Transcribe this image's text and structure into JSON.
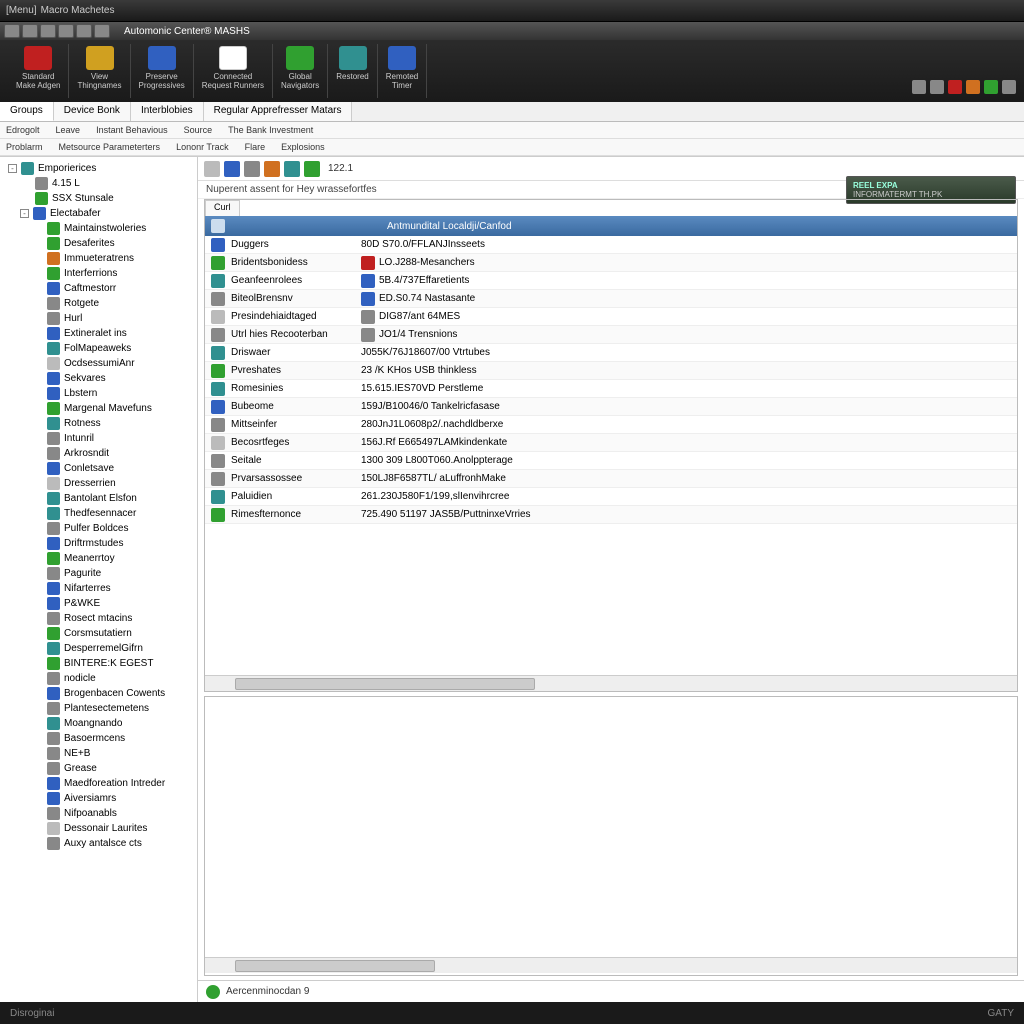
{
  "titlebar": {
    "app": "Macro Machetes"
  },
  "ribbon_header": {
    "title": "Automonic Center® MASHS"
  },
  "ribbon": [
    {
      "label": "Standard\nMake Adgen",
      "color": "c-red"
    },
    {
      "label": "View\nThingnames",
      "color": "c-yellow"
    },
    {
      "label": "Preserve\nProgressives",
      "color": "c-blue"
    },
    {
      "label": "Connected\nRequest Runners",
      "color": "c-white"
    },
    {
      "label": "Global\nNavigators",
      "color": "c-green"
    },
    {
      "label": "Restored",
      "color": "c-teal"
    },
    {
      "label": "Remoted\nTimer",
      "color": "c-blue"
    }
  ],
  "tray_colors": [
    "c-grey",
    "c-grey",
    "c-red",
    "c-orange",
    "c-green",
    "c-grey"
  ],
  "tabs": [
    {
      "label": "Groups",
      "active": true
    },
    {
      "label": "Device Bonk"
    },
    {
      "label": "Interblobies"
    },
    {
      "label": "Regular Apprefresser Matars"
    }
  ],
  "submenu1": [
    "Edrogolt",
    "Leave",
    "Instant Behavious",
    "Source",
    "The Bank Investment"
  ],
  "submenu2": [
    "Problarm",
    "Metsource Parameterters",
    "Lononr Track",
    "Flare",
    "Explosions"
  ],
  "tree": [
    {
      "lvl": 0,
      "exp": "-",
      "icon": "c-teal",
      "label": "Emporierices"
    },
    {
      "lvl": 1,
      "exp": "",
      "icon": "c-grey",
      "label": "4.15 L"
    },
    {
      "lvl": 1,
      "exp": "",
      "icon": "c-green",
      "label": "SSX Stunsale"
    },
    {
      "lvl": 1,
      "exp": "-",
      "icon": "c-blue",
      "label": "Electabafer"
    },
    {
      "lvl": 2,
      "exp": "",
      "icon": "c-green",
      "label": "Maintainstwoleries"
    },
    {
      "lvl": 2,
      "exp": "",
      "icon": "c-green",
      "label": "Desaferites"
    },
    {
      "lvl": 2,
      "exp": "",
      "icon": "c-orange",
      "label": "Immueteratrens"
    },
    {
      "lvl": 2,
      "exp": "",
      "icon": "c-green",
      "label": "Interferrions"
    },
    {
      "lvl": 2,
      "exp": "",
      "icon": "c-blue",
      "label": "Caftmestorr"
    },
    {
      "lvl": 2,
      "exp": "",
      "icon": "c-grey",
      "label": "Rotgete"
    },
    {
      "lvl": 2,
      "exp": "",
      "icon": "c-grey",
      "label": "Hurl"
    },
    {
      "lvl": 2,
      "exp": "",
      "icon": "c-blue",
      "label": "Extineralet ins"
    },
    {
      "lvl": 2,
      "exp": "",
      "icon": "c-teal",
      "label": "FolMapeaweks"
    },
    {
      "lvl": 2,
      "exp": "",
      "icon": "c-lgrey",
      "label": "OcdsessumiAnr"
    },
    {
      "lvl": 2,
      "exp": "",
      "icon": "c-blue",
      "label": "Sekvares"
    },
    {
      "lvl": 2,
      "exp": "",
      "icon": "c-blue",
      "label": "Lbstern"
    },
    {
      "lvl": 2,
      "exp": "",
      "icon": "c-green",
      "label": "Margenal Mavefuns"
    },
    {
      "lvl": 2,
      "exp": "",
      "icon": "c-teal",
      "label": "Rotness"
    },
    {
      "lvl": 2,
      "exp": "",
      "icon": "c-grey",
      "label": "Intunril"
    },
    {
      "lvl": 2,
      "exp": "",
      "icon": "c-grey",
      "label": "Arkrosndit"
    },
    {
      "lvl": 2,
      "exp": "",
      "icon": "c-blue",
      "label": "Conletsave"
    },
    {
      "lvl": 2,
      "exp": "",
      "icon": "c-lgrey",
      "label": "Dresserrien"
    },
    {
      "lvl": 2,
      "exp": "",
      "icon": "c-teal",
      "label": "Bantolant Elsfon"
    },
    {
      "lvl": 2,
      "exp": "",
      "icon": "c-teal",
      "label": "Thedfesennacer"
    },
    {
      "lvl": 2,
      "exp": "",
      "icon": "c-grey",
      "label": "Pulfer Boldces"
    },
    {
      "lvl": 2,
      "exp": "",
      "icon": "c-blue",
      "label": "Driftrmstudes"
    },
    {
      "lvl": 2,
      "exp": "",
      "icon": "c-green",
      "label": "Meanerrtoy"
    },
    {
      "lvl": 2,
      "exp": "",
      "icon": "c-grey",
      "label": "Pagurite"
    },
    {
      "lvl": 2,
      "exp": "",
      "icon": "c-blue",
      "label": "Nifarterres"
    },
    {
      "lvl": 2,
      "exp": "",
      "icon": "c-blue",
      "label": "P&WKE"
    },
    {
      "lvl": 2,
      "exp": "",
      "icon": "c-grey",
      "label": "Rosect mtacins"
    },
    {
      "lvl": 2,
      "exp": "",
      "icon": "c-green",
      "label": "Corsmsutatiern"
    },
    {
      "lvl": 2,
      "exp": "",
      "icon": "c-teal",
      "label": "DesperremelGifrn"
    },
    {
      "lvl": 2,
      "exp": "",
      "icon": "c-green",
      "label": "BINTERE:K EGEST"
    },
    {
      "lvl": 2,
      "exp": "",
      "icon": "c-grey",
      "label": "nodicle"
    },
    {
      "lvl": 2,
      "exp": "",
      "icon": "c-blue",
      "label": "Brogenbacen Cowents"
    },
    {
      "lvl": 2,
      "exp": "",
      "icon": "c-grey",
      "label": "Plantesectemetens"
    },
    {
      "lvl": 2,
      "exp": "",
      "icon": "c-teal",
      "label": "Moangnando"
    },
    {
      "lvl": 2,
      "exp": "",
      "icon": "c-grey",
      "label": "Basoermcens"
    },
    {
      "lvl": 2,
      "exp": "",
      "icon": "c-grey",
      "label": "NE+B"
    },
    {
      "lvl": 2,
      "exp": "",
      "icon": "c-grey",
      "label": "Grease"
    },
    {
      "lvl": 2,
      "exp": "",
      "icon": "c-blue",
      "label": "Maedforeation Intreder"
    },
    {
      "lvl": 2,
      "exp": "",
      "icon": "c-blue",
      "label": "Aiversiamrs"
    },
    {
      "lvl": 2,
      "exp": "",
      "icon": "c-grey",
      "label": "Nifpoanabls"
    },
    {
      "lvl": 2,
      "exp": "",
      "icon": "c-lgrey",
      "label": "Dessonair Laurites"
    },
    {
      "lvl": 2,
      "exp": "",
      "icon": "c-grey",
      "label": "Auxy antalsce cts"
    }
  ],
  "toolbar_icons": [
    "c-lgrey",
    "c-blue",
    "c-grey",
    "c-orange",
    "c-teal",
    "c-green"
  ],
  "toolbar_text": "122.1",
  "subtitle": "Nuperent assent for Hey wrassefortfes",
  "banner": {
    "line1": "REEL EXPA",
    "line2": "INFORMATERMT TH.PK"
  },
  "grid": {
    "tab": "Curl",
    "header_col1": "",
    "header_col2": "Antmundital Localdji/Canfod",
    "rows": [
      {
        "icon": "c-blue",
        "c1": "Duggers",
        "icon2": "",
        "c2": "80D S70.0/FFLANJInsseets"
      },
      {
        "icon": "c-green",
        "c1": "Bridentsbonidess",
        "icon2": "c-red",
        "c2": "LO.J288-Mesanchers"
      },
      {
        "icon": "c-teal",
        "c1": "Geanfeenrolees",
        "icon2": "c-blue",
        "c2": "5B.4/737Effaretients"
      },
      {
        "icon": "c-grey",
        "c1": "BiteolBrensnv",
        "icon2": "c-blue",
        "c2": "ED.S0.74 Nastasante"
      },
      {
        "icon": "c-lgrey",
        "c1": "Presindehiaidtaged",
        "icon2": "c-grey",
        "c2": "DIG87/ant 64MES"
      },
      {
        "icon": "c-grey",
        "c1": "Utrl hies Recooterban",
        "icon2": "c-grey",
        "c2": "JO1/4 Trensnions"
      },
      {
        "icon": "c-teal",
        "c1": "Driswaer",
        "icon2": "",
        "c2": "J055K/76J18607/00 Vtrtubes"
      },
      {
        "icon": "c-green",
        "c1": "Pvreshates",
        "icon2": "",
        "c2": "23 /K KHos USB thinkless"
      },
      {
        "icon": "c-teal",
        "c1": "Romesinies",
        "icon2": "",
        "c2": "15.615.IES70VD Perstleme"
      },
      {
        "icon": "c-blue",
        "c1": "Bubeome",
        "icon2": "",
        "c2": "159J/B10046/0 Tankelricfasase"
      },
      {
        "icon": "c-grey",
        "c1": "Mittseinfer",
        "icon2": "",
        "c2": "280JnJ1L0608p2/.nachdldberxe"
      },
      {
        "icon": "c-lgrey",
        "c1": "Becosrtfeges",
        "icon2": "",
        "c2": "156J.Rf E665497LAMkindenkate"
      },
      {
        "icon": "c-grey",
        "c1": "Seitale",
        "icon2": "",
        "c2": "1300 309 L800T060.Anolppterage"
      },
      {
        "icon": "c-grey",
        "c1": "Prvarsassossee",
        "icon2": "",
        "c2": "150LJ8F6587TL/ aLuffronhMake"
      },
      {
        "icon": "c-teal",
        "c1": "Paluidien",
        "icon2": "",
        "c2": "261.230J580F1/199,slIenvihrcree"
      },
      {
        "icon": "c-green",
        "c1": "Rimesfternonce",
        "icon2": "",
        "c2": "725.490 51197 JAS5B/PuttninxeVrries"
      }
    ]
  },
  "status_inner": {
    "text": "Aercenminocdan 9"
  },
  "footer": {
    "left": "Disroginai",
    "right": "GATY"
  }
}
